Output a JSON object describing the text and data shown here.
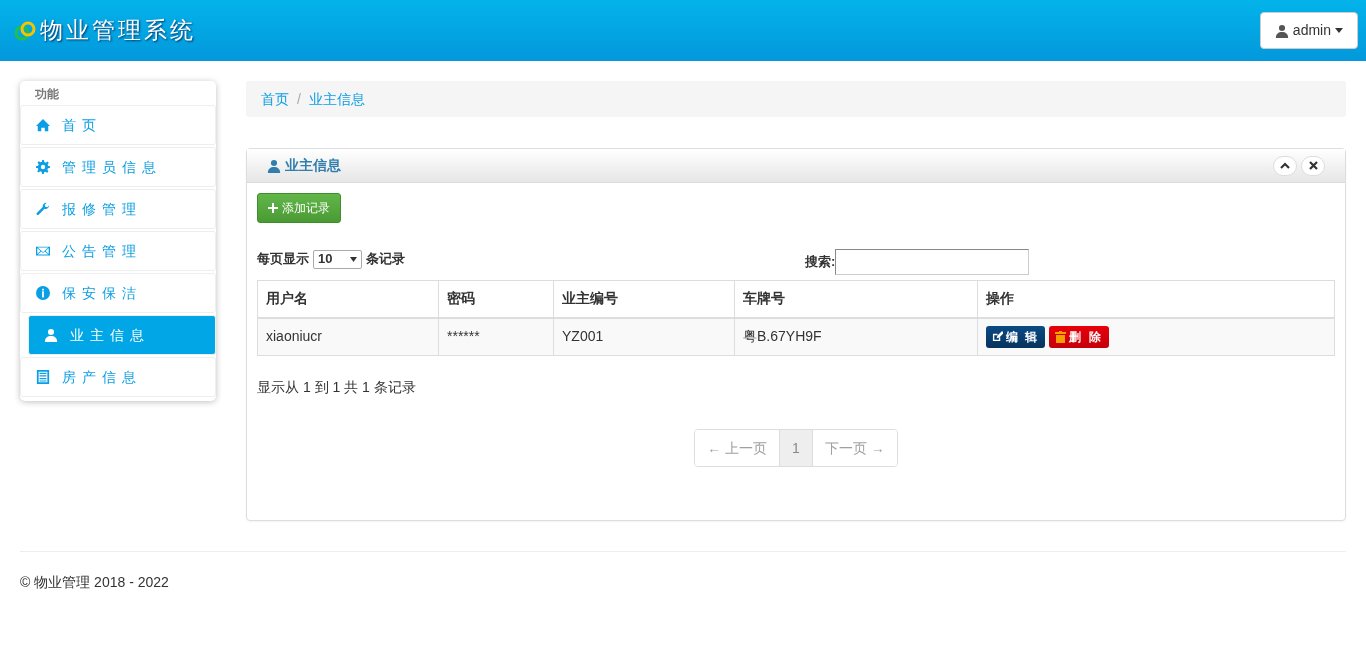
{
  "header": {
    "title": "物业管理系统",
    "user_menu": "admin"
  },
  "sidebar": {
    "heading": "功能",
    "items": [
      {
        "label": "首页",
        "selected": false
      },
      {
        "label": "管理员信息",
        "selected": false
      },
      {
        "label": "报修管理",
        "selected": false
      },
      {
        "label": "公告管理",
        "selected": false
      },
      {
        "label": "保安保洁",
        "selected": false
      },
      {
        "label": "业主信息",
        "selected": true
      },
      {
        "label": "房产信息",
        "selected": false
      }
    ]
  },
  "breadcrumb": {
    "separator": "/",
    "items": [
      {
        "label": "首页"
      },
      {
        "label": "业主信息"
      }
    ]
  },
  "panel": {
    "title": "业主信息",
    "add_button": "添加记录",
    "length": {
      "before": "每页显示",
      "value": "10",
      "after": "条记录"
    },
    "search_label": "搜索:",
    "table": {
      "columns": [
        "用户名",
        "密码",
        "业主编号",
        "车牌号",
        "操作"
      ],
      "rows": [
        {
          "cells": [
            "xiaoniucr",
            "******",
            "YZ001",
            "粤B.67YH9F"
          ],
          "edit": "编 辑",
          "delete": "删 除"
        }
      ]
    },
    "info": "显示从 1 到 1 共 1 条记录",
    "pagination": [
      {
        "label": "← 上一页",
        "disabled": true,
        "selected": false
      },
      {
        "label": "1",
        "disabled": false,
        "selected": true
      },
      {
        "label": "下一页 →",
        "disabled": true,
        "selected": false
      }
    ]
  },
  "footer": "© 物业管理 2018 - 2022"
}
